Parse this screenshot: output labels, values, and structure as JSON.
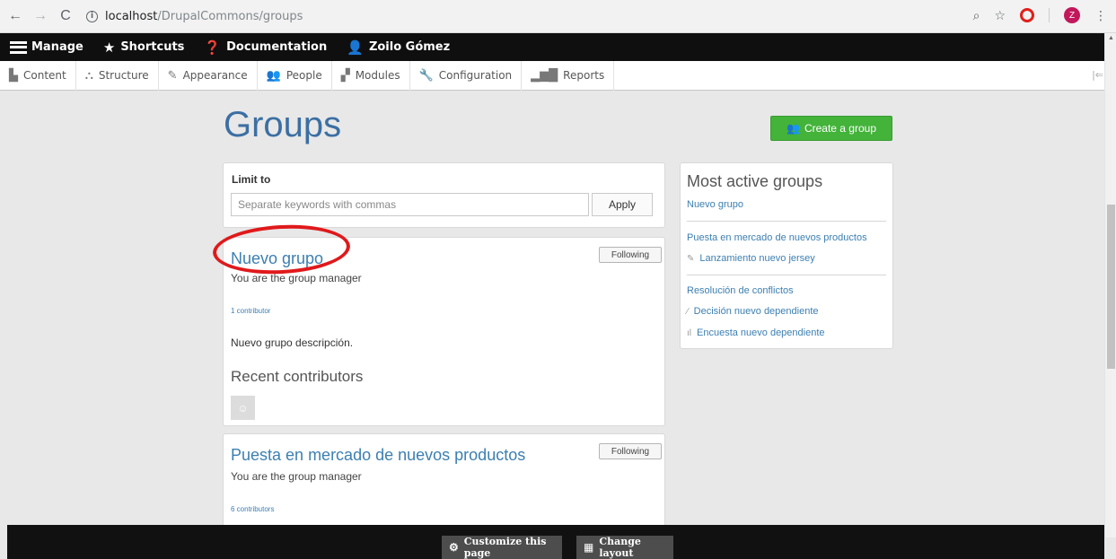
{
  "browser": {
    "url_host": "localhost",
    "url_path": "/DrupalCommons/groups",
    "profile_initial": "Z"
  },
  "toolbar": {
    "manage": "Manage",
    "shortcuts": "Shortcuts",
    "documentation": "Documentation",
    "user": "Zoilo Gómez"
  },
  "admin_menu": {
    "items": [
      "Content",
      "Structure",
      "Appearance",
      "People",
      "Modules",
      "Configuration",
      "Reports"
    ]
  },
  "page": {
    "title": "Groups",
    "create_button": "Create a group"
  },
  "filter": {
    "label": "Limit to",
    "placeholder": "Separate keywords with commas",
    "apply": "Apply"
  },
  "groups": [
    {
      "title": "Nuevo grupo",
      "following": "Following",
      "manager": "You are the group manager",
      "contributors": "1 contributor",
      "description": "Nuevo grupo descripción.",
      "recent_title": "Recent contributors"
    },
    {
      "title": "Puesta en mercado de nuevos productos",
      "following": "Following",
      "manager": "You are the group manager",
      "contributors": "6 contributors"
    }
  ],
  "sidebar": {
    "title": "Most active groups",
    "group1": "Nuevo grupo",
    "group2": "Puesta en mercado de nuevos productos",
    "group2_sub": "Lanzamiento nuevo jersey",
    "group3": "Resolución de conflictos",
    "group3_sub1": "Decisión nuevo dependiente",
    "group3_sub2": "Encuesta nuevo dependiente"
  },
  "bottom_bar": {
    "customize": "Customize this page",
    "change_layout": "Change layout"
  },
  "colors": {
    "accent_blue": "#3c7fb1",
    "create_green": "#43b33a",
    "toolbar_black": "#0f0f0f",
    "annotation_red": "#e0191b"
  }
}
